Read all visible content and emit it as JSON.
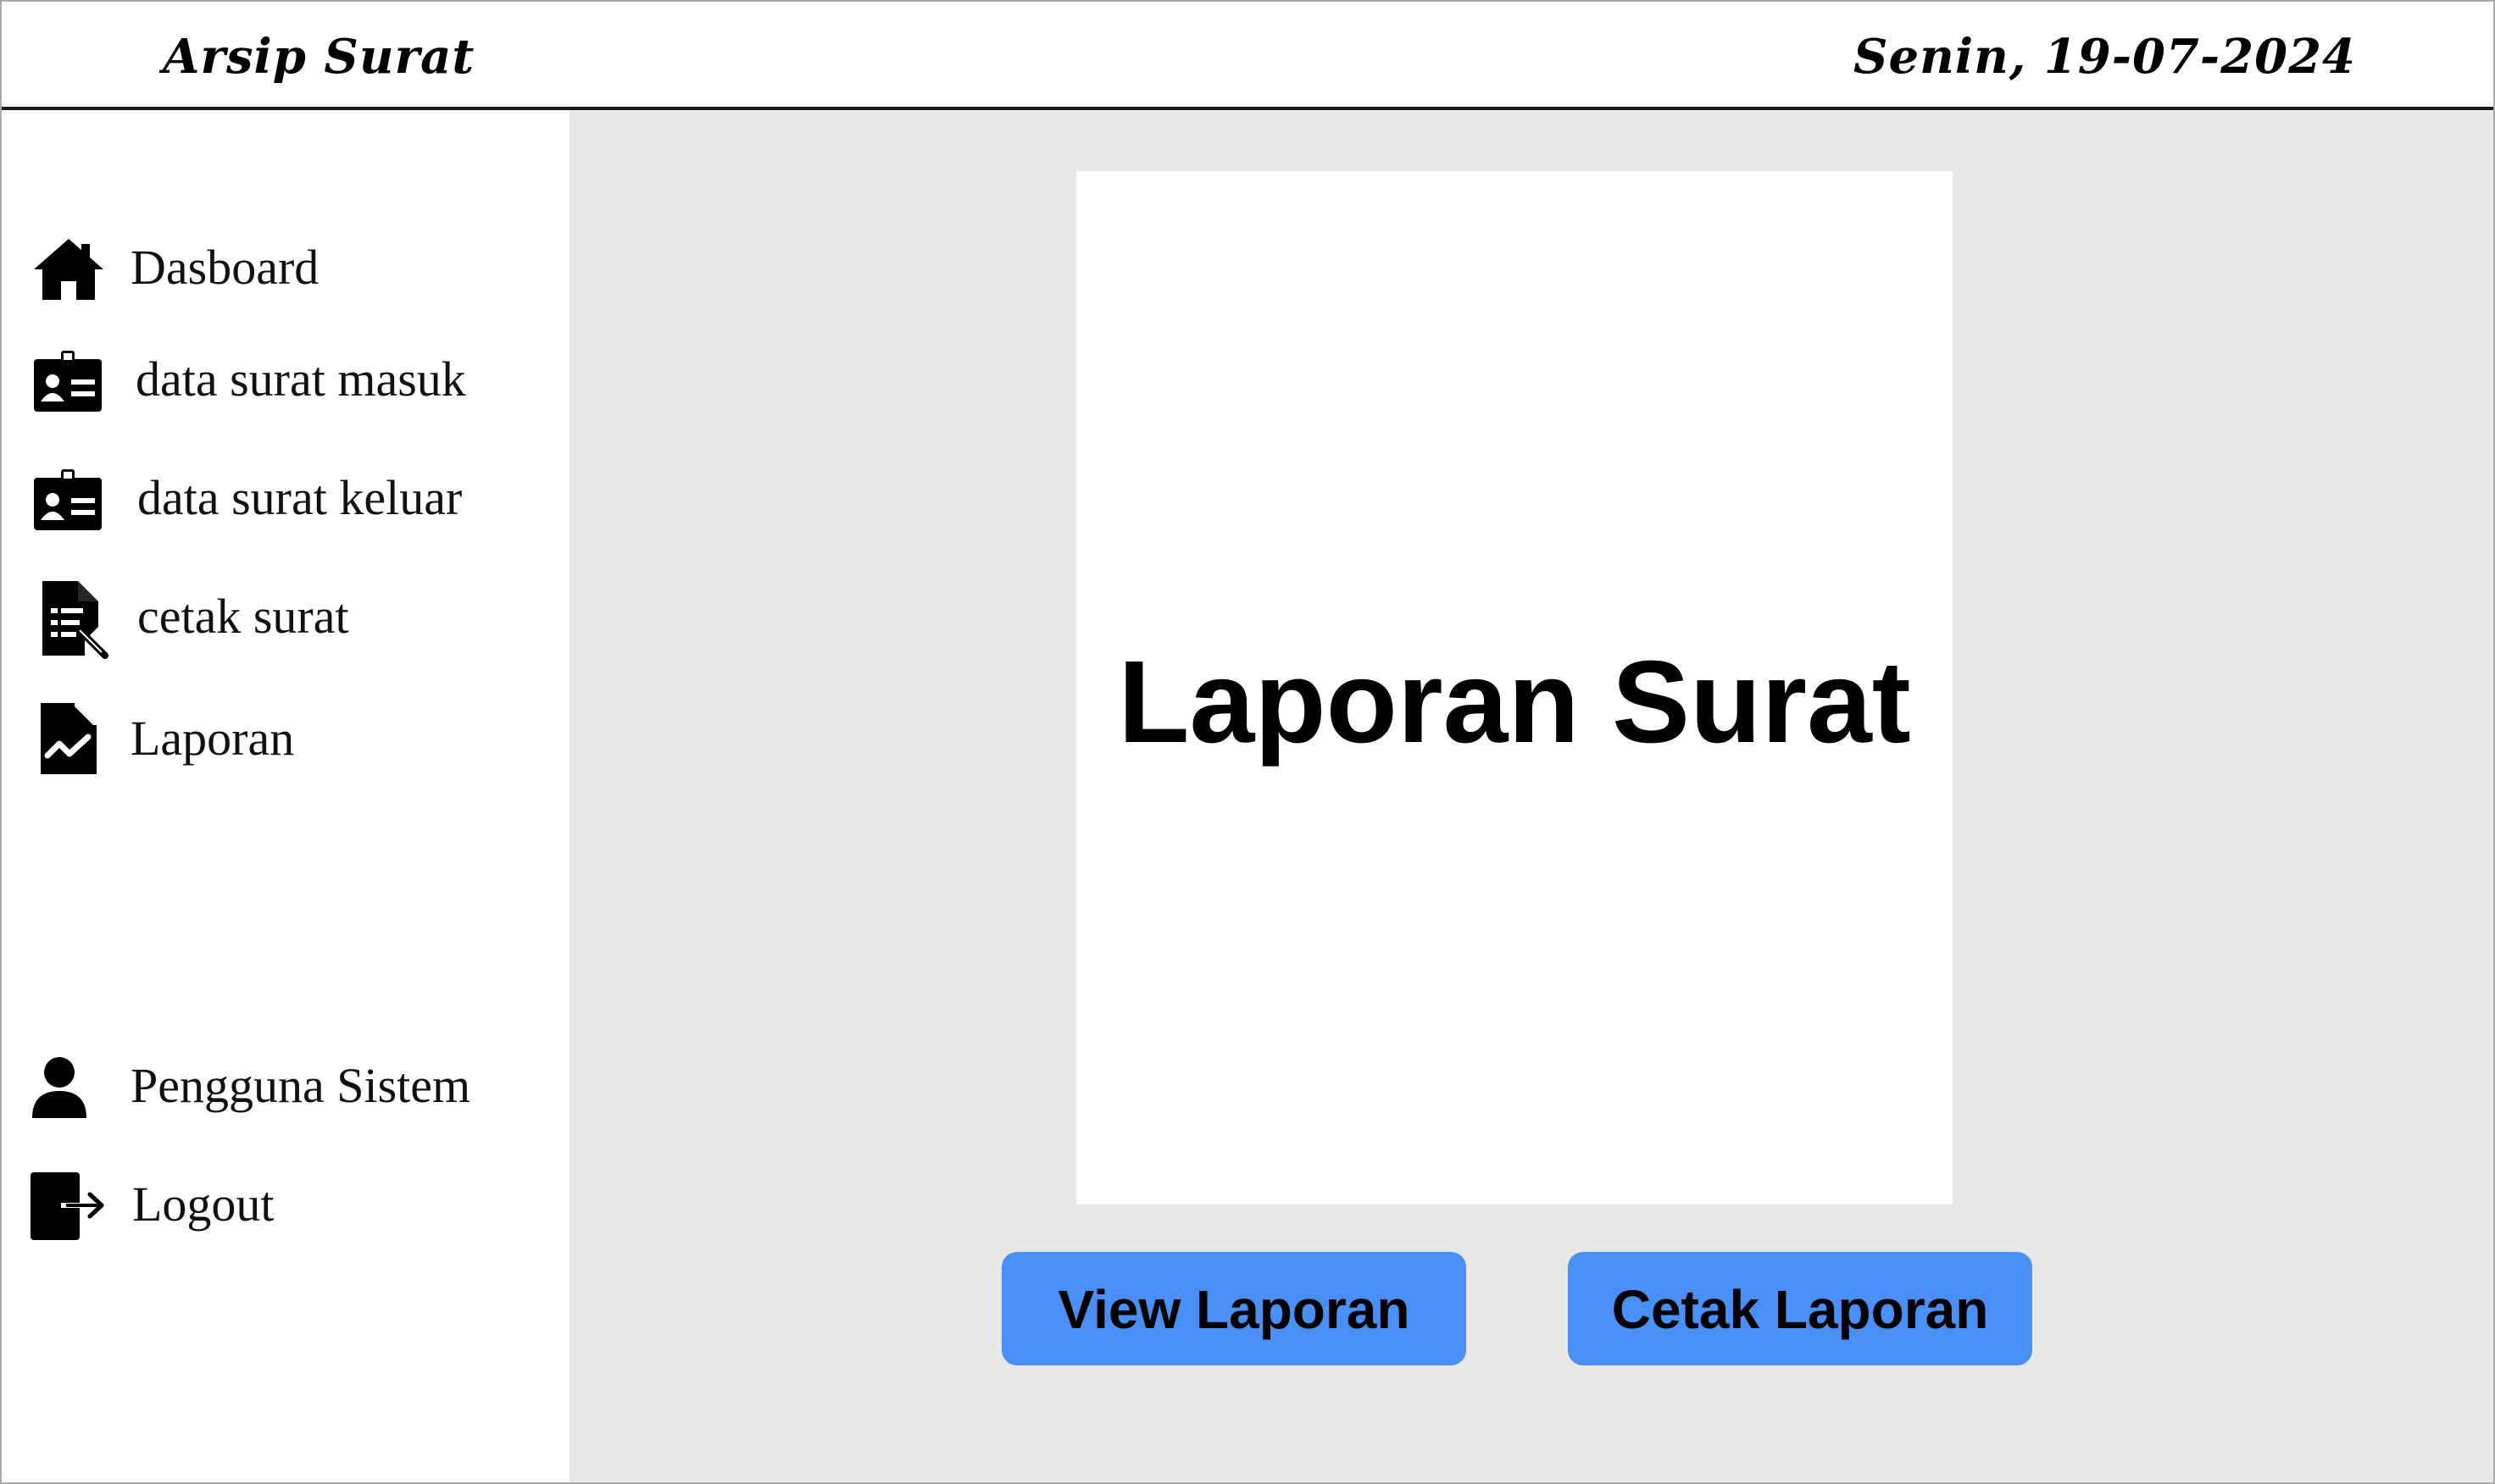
{
  "header": {
    "app_title": "Arsip Surat",
    "date": "Senin, 19-07-2024"
  },
  "sidebar": {
    "items": [
      {
        "label": "Dasboard",
        "icon": "home-icon"
      },
      {
        "label": "data surat masuk",
        "icon": "id-card-icon"
      },
      {
        "label": "data surat keluar",
        "icon": "id-card-icon"
      },
      {
        "label": "cetak surat",
        "icon": "document-list-icon"
      },
      {
        "label": "Laporan",
        "icon": "chart-file-icon"
      }
    ],
    "bottom_items": [
      {
        "label": "Pengguna Sistem",
        "icon": "user-icon"
      },
      {
        "label": "Logout",
        "icon": "logout-icon"
      }
    ]
  },
  "main": {
    "report_title": "Laporan Surat",
    "view_button": "View Laporan",
    "print_button": "Cetak Laporan"
  },
  "colors": {
    "accent": "#4a8ff5",
    "main_background": "#e8e8e8",
    "card_background": "#ffffff"
  }
}
